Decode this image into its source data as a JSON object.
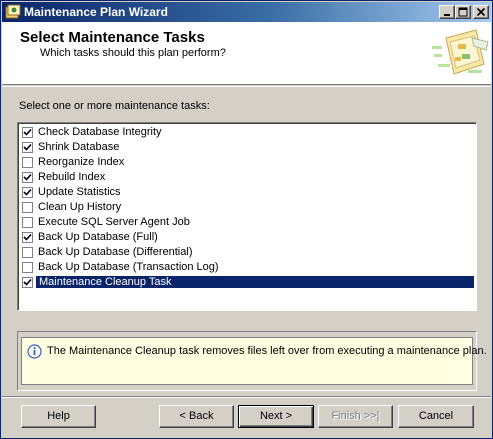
{
  "window": {
    "title": "Maintenance Plan Wizard"
  },
  "header": {
    "title": "Select Maintenance Tasks",
    "subtitle": "Which tasks should this plan perform?"
  },
  "prompt": "Select one or more maintenance tasks:",
  "tasks": [
    {
      "label": "Check Database Integrity",
      "checked": true
    },
    {
      "label": "Shrink Database",
      "checked": true
    },
    {
      "label": "Reorganize Index",
      "checked": false
    },
    {
      "label": "Rebuild Index",
      "checked": true
    },
    {
      "label": "Update Statistics",
      "checked": true
    },
    {
      "label": "Clean Up History",
      "checked": false
    },
    {
      "label": "Execute SQL Server Agent Job",
      "checked": false
    },
    {
      "label": "Back Up Database (Full)",
      "checked": true
    },
    {
      "label": "Back Up Database (Differential)",
      "checked": false
    },
    {
      "label": "Back Up Database (Transaction Log)",
      "checked": false
    },
    {
      "label": "Maintenance Cleanup Task",
      "checked": true,
      "selected": true
    }
  ],
  "description": "The Maintenance Cleanup task removes files left over from executing a maintenance plan.",
  "buttons": {
    "help": "Help",
    "back": "< Back",
    "next": "Next >",
    "finish": "Finish >>|",
    "cancel": "Cancel"
  },
  "colors": {
    "selection": "#0a246a",
    "tooltip_bg": "#ffffe1",
    "face": "#d4d0c8"
  },
  "icons": {
    "app": "wizard-app-icon",
    "minimize": "minimize-icon",
    "maximize": "maximize-icon",
    "close": "close-icon",
    "info": "info-icon",
    "header": "wizard-graphic-icon"
  }
}
